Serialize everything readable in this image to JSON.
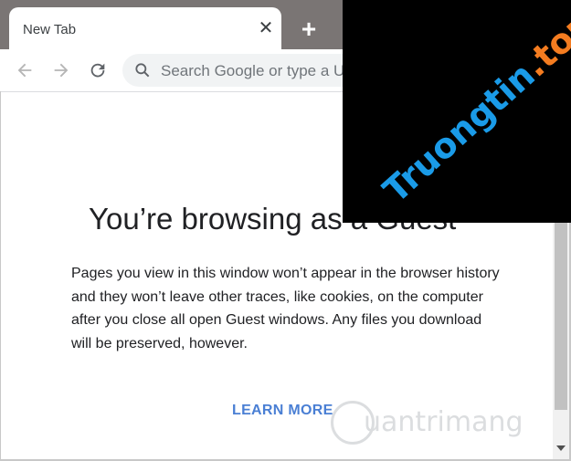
{
  "tab": {
    "title": "New Tab"
  },
  "toolbar": {
    "omnibox_placeholder": "Search Google or type a U"
  },
  "content": {
    "headline": "You’re browsing as a Guest",
    "body": "Pages you view in this window won’t appear in the browser history and they won’t leave other traces, like cookies, on the computer after you close all open Guest windows. Any files you download will be preserved, however.",
    "learn_more": "LEARN MORE"
  },
  "watermarks": {
    "top": {
      "main": "Truongtin",
      "tld": ".top"
    },
    "bottom": "uantrimang"
  },
  "colors": {
    "tabstrip": "#7a7574",
    "link": "#4a7fd4",
    "watermark_blue": "#1a9be8",
    "watermark_orange": "#f47c20"
  }
}
